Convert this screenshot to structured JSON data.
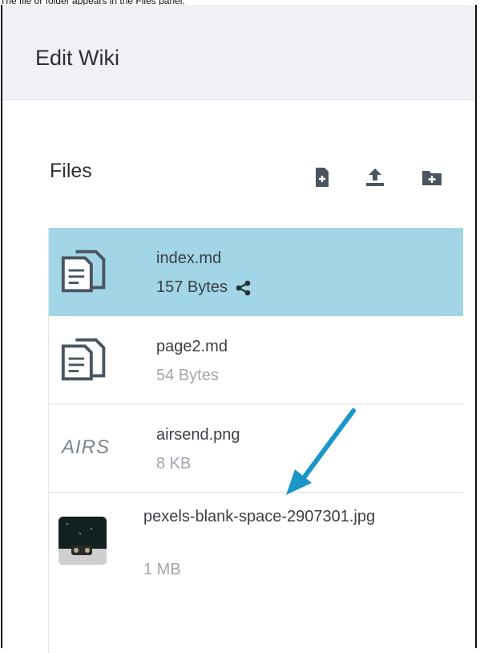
{
  "caption": "The file or folder appears in the Files panel.",
  "header": {
    "title": "Edit Wiki"
  },
  "files_panel": {
    "title": "Files",
    "toolbar": [
      {
        "name": "new-file-icon"
      },
      {
        "name": "upload-icon"
      },
      {
        "name": "new-folder-icon"
      }
    ],
    "items": [
      {
        "name": "index.md",
        "size": "157 Bytes",
        "icon": "document-copy-icon",
        "selected": true,
        "shared": true
      },
      {
        "name": "page2.md",
        "size": "54 Bytes",
        "icon": "document-copy-icon",
        "selected": false
      },
      {
        "name": "airsend.png",
        "size": "8 KB",
        "icon": "image-thumbnail",
        "thumb_text": "AIRS",
        "selected": false
      },
      {
        "name": "pexels-blank-space-2907301.jpg",
        "size": "1 MB",
        "icon": "photo-thumbnail",
        "selected": false
      }
    ]
  },
  "annotation": {
    "type": "arrow",
    "color": "#1a96c8"
  },
  "colors": {
    "selected_row": "#a2d5e6",
    "header_bg": "#eff1f4",
    "icon": "#4a5560"
  }
}
